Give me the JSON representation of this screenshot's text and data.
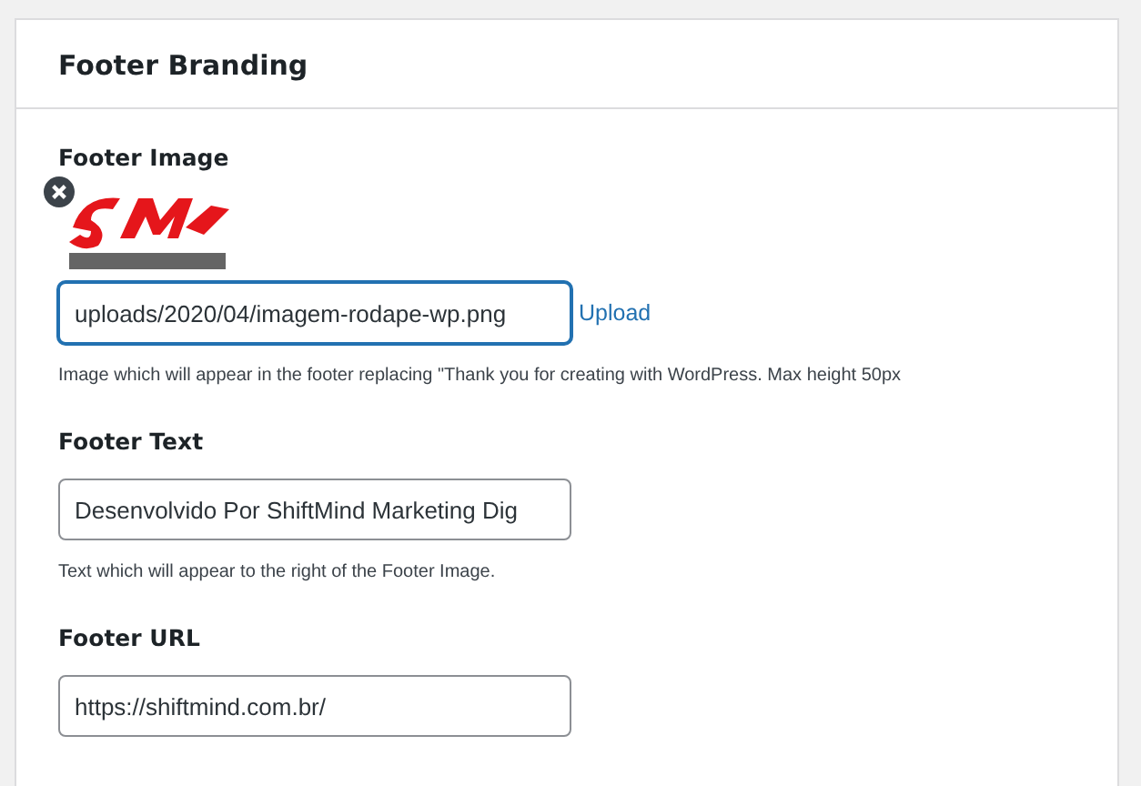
{
  "panel": {
    "title": "Footer Branding"
  },
  "fields": [
    {
      "label": "Footer Image",
      "value": "uploads/2020/04/imagem-rodape-wp.png",
      "focused": true,
      "link": "Upload",
      "description": "Image which will appear in the footer replacing \"Thank you for creating with WordPress. Max height 50px"
    },
    {
      "kind": "text",
      "label": "Footer Text",
      "value": "Desenvolvido Por ShiftMind Marketing Dig",
      "focused": false,
      "description": "Text which will appear to the right of the Footer Image."
    },
    {
      "kind": "text",
      "label": "Footer URL",
      "value": "https://shiftmind.com.br/",
      "focused": false
    }
  ]
}
